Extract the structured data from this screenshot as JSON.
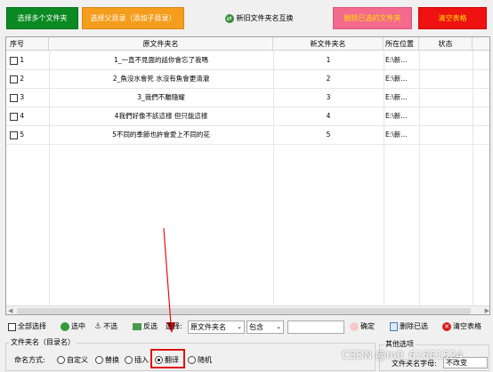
{
  "toolbar": {
    "select_multiple": "选择多个文件夹",
    "select_parent": "选择父目录（添加子目录）",
    "swap_names": "新旧文件夹名互换",
    "delete_selected_folders": "删除已选的文件夹",
    "clear_table": "清空表格"
  },
  "table": {
    "headers": [
      "序号",
      "原文件夹名",
      "新文件夹名",
      "所在位置",
      "状态"
    ],
    "rows": [
      {
        "no": "1",
        "orig": "1_一直不見面的話你會忘了我嗎",
        "new": "1",
        "loc": "E:\\新...",
        "status": ""
      },
      {
        "no": "2",
        "orig": "2_魚沒水會死 水沒有魚會更清澈",
        "new": "2",
        "loc": "E:\\新...",
        "status": ""
      },
      {
        "no": "3",
        "orig": "3_我們不離隨耀",
        "new": "3",
        "loc": "E:\\新...",
        "status": ""
      },
      {
        "no": "4",
        "orig": "4我們好像不該這樣 但只能這樣",
        "new": "4",
        "loc": "E:\\新...",
        "status": ""
      },
      {
        "no": "5",
        "orig": "5不同的季節也許會愛上不同的花",
        "new": "5",
        "loc": "E:\\新...",
        "status": ""
      }
    ]
  },
  "bottom": {
    "select_all": "全部选择",
    "select": "选中",
    "deselect": "不选",
    "invert": "反选",
    "filter_label": "选择:",
    "field_value": "原文件夹名",
    "mode_value": "包含",
    "filter_input": "",
    "confirm": "确定",
    "delete_selected": "删除已选",
    "clear_table": "清空表格"
  },
  "naming": {
    "group_title": "文件夹名（目录名）",
    "method_label": "命名方式:",
    "options": [
      "自定义",
      "替换",
      "插入",
      "翻译",
      "随机"
    ],
    "selected": "翻译"
  },
  "other": {
    "group_title": "其他选项",
    "case_label": "文件夹名字母:",
    "case_value": "不改变"
  },
  "watermark": "CSDN @m0_61661524",
  "colors": {
    "green": "#0b8a24",
    "orange": "#f59d1c",
    "pink": "#f46a8c",
    "red": "#ee1212",
    "highlight": "#e01010"
  }
}
